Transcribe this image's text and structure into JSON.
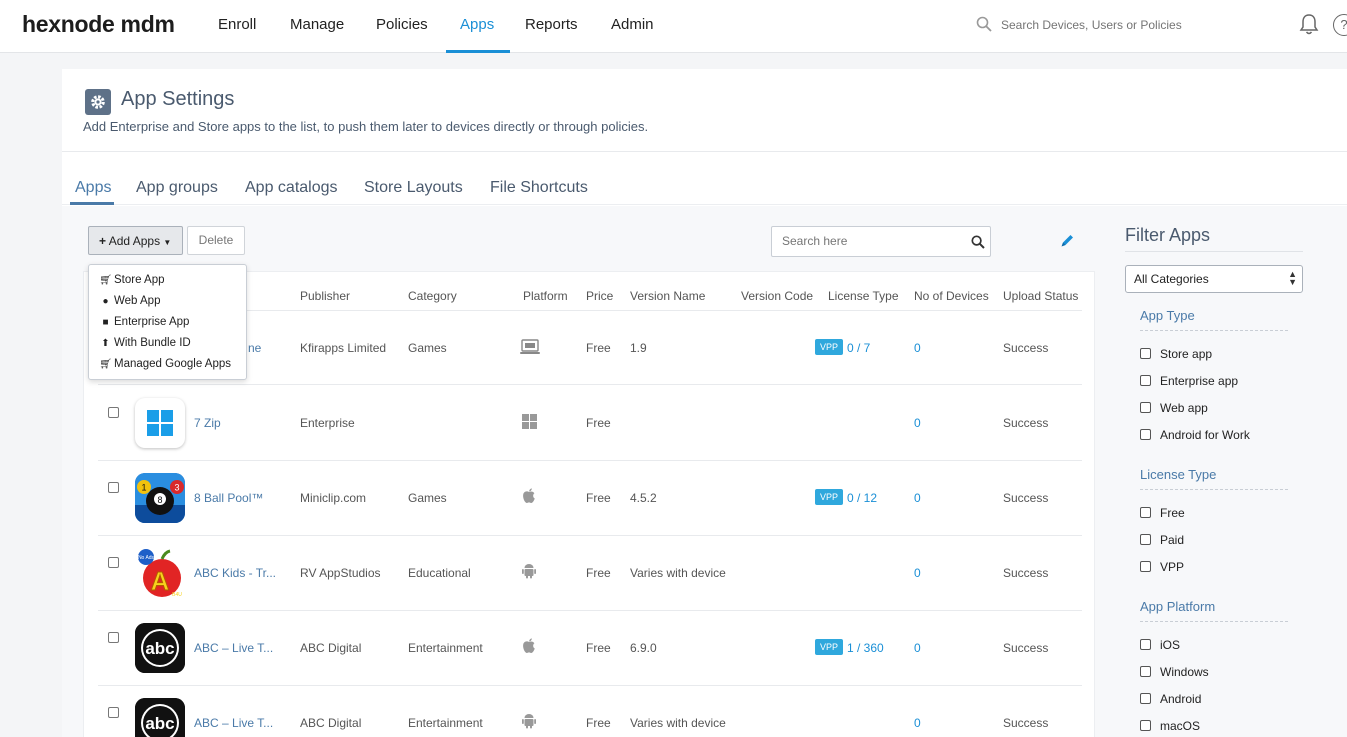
{
  "brand": {
    "logo": "hexnode mdm"
  },
  "nav": {
    "items": [
      {
        "label": "Enroll"
      },
      {
        "label": "Manage"
      },
      {
        "label": "Policies"
      },
      {
        "label": "Apps"
      },
      {
        "label": "Reports"
      },
      {
        "label": "Admin"
      }
    ],
    "active": "Apps",
    "search_placeholder": "Search Devices, Users or Policies",
    "help_glyph": "?"
  },
  "page": {
    "title": "App Settings",
    "subtitle": "Add Enterprise and Store apps to the list, to push them later to devices directly or through policies."
  },
  "tabs": [
    {
      "label": "Apps"
    },
    {
      "label": "App groups"
    },
    {
      "label": "App catalogs"
    },
    {
      "label": "Store Layouts"
    },
    {
      "label": "File Shortcuts"
    }
  ],
  "toolbar": {
    "add_label": "Add Apps",
    "delete_label": "Delete",
    "search_placeholder": "Search here"
  },
  "add_menu": {
    "items": [
      {
        "label": "Store App",
        "icon": "cart-icon"
      },
      {
        "label": "Web App",
        "icon": "globe-icon"
      },
      {
        "label": "Enterprise App",
        "icon": "briefcase-icon"
      },
      {
        "label": "With Bundle ID",
        "icon": "upload-icon"
      },
      {
        "label": "Managed Google Apps",
        "icon": "cart-icon"
      }
    ]
  },
  "table": {
    "columns": [
      "Publisher",
      "Category",
      "Platform",
      "Price",
      "Version Name",
      "Version Code",
      "License Type",
      "No of Devices",
      "Upload Status"
    ],
    "rows": [
      {
        "name": "ne",
        "publisher": "Kfirapps Limited",
        "category": "Games",
        "platform": "macos",
        "price": "Free",
        "version_name": "1.9",
        "version_code": "",
        "license_badge": "VPP",
        "license_count": "0 / 7",
        "devices": "0",
        "status": "Success"
      },
      {
        "name": "7 Zip",
        "publisher": "Enterprise",
        "category": "",
        "platform": "windows",
        "price": "Free",
        "version_name": "",
        "version_code": "",
        "license_badge": "",
        "license_count": "",
        "devices": "0",
        "status": "Success"
      },
      {
        "name": "8 Ball Pool™",
        "publisher": "Miniclip.com",
        "category": "Games",
        "platform": "ios",
        "price": "Free",
        "version_name": "4.5.2",
        "version_code": "",
        "license_badge": "VPP",
        "license_count": "0 / 12",
        "devices": "0",
        "status": "Success"
      },
      {
        "name": "ABC Kids - Tr...",
        "publisher": "RV AppStudios",
        "category": "Educational",
        "platform": "android",
        "price": "Free",
        "version_name": "Varies with device",
        "version_code": "",
        "license_badge": "",
        "license_count": "",
        "devices": "0",
        "status": "Success"
      },
      {
        "name": "ABC – Live T...",
        "publisher": "ABC Digital",
        "category": "Entertainment",
        "platform": "ios",
        "price": "Free",
        "version_name": "6.9.0",
        "version_code": "",
        "license_badge": "VPP",
        "license_count": "1 / 360",
        "devices": "0",
        "status": "Success"
      },
      {
        "name": "ABC – Live T...",
        "publisher": "ABC Digital",
        "category": "Entertainment",
        "platform": "android",
        "price": "Free",
        "version_name": "Varies with device",
        "version_code": "",
        "license_badge": "",
        "license_count": "",
        "devices": "0",
        "status": "Success"
      }
    ],
    "icon_texts": {
      "ball_numbers": [
        "1",
        "8",
        "3"
      ],
      "kids_badge": "No Ads",
      "kids_letter": "A",
      "kids_tag": "B4U",
      "abc": "abc"
    }
  },
  "filter": {
    "title": "Filter Apps",
    "category_select": "All Categories",
    "groups": [
      {
        "label": "App Type",
        "options": [
          "Store app",
          "Enterprise app",
          "Web app",
          "Android for Work"
        ]
      },
      {
        "label": "License Type",
        "options": [
          "Free",
          "Paid",
          "VPP"
        ]
      },
      {
        "label": "App Platform",
        "options": [
          "iOS",
          "Windows",
          "Android",
          "macOS"
        ]
      }
    ]
  },
  "colors": {
    "accent": "#1a8fd6",
    "vpp_badge": "#2fa8dd",
    "title_slate": "#4a5a6e"
  }
}
